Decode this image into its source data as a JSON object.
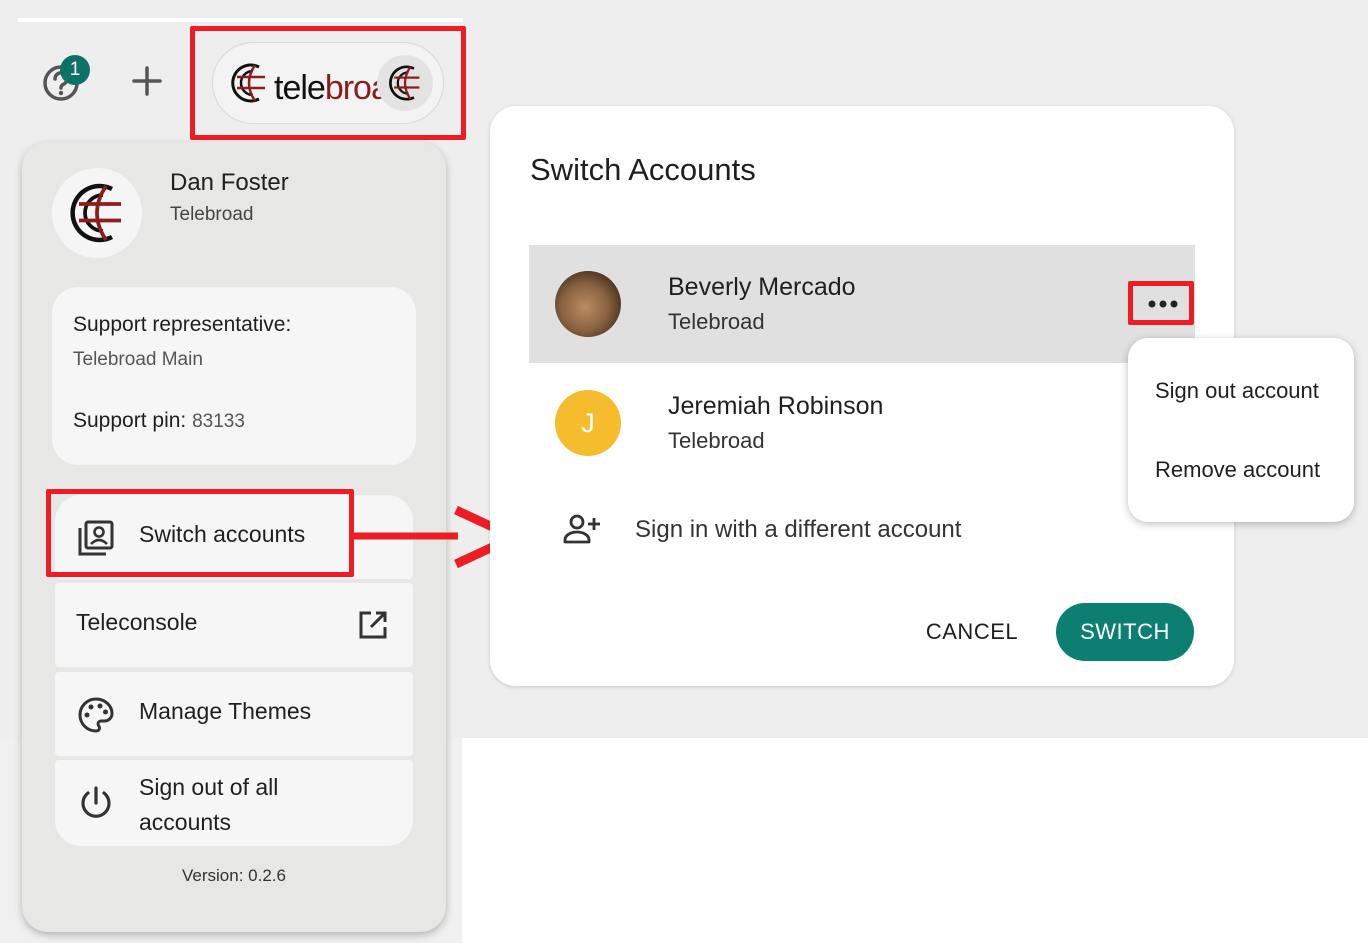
{
  "topbar": {
    "help_badge": "1",
    "logo_tele": "tele",
    "logo_broad": "broad"
  },
  "profile": {
    "name": "Dan Foster",
    "org": "Telebroad"
  },
  "support": {
    "rep_label": "Support representative:",
    "rep_value": "Telebroad Main",
    "pin_label": "Support pin:",
    "pin_value": "83133"
  },
  "menu": {
    "switch_accounts": "Switch accounts",
    "teleconsole": "Teleconsole",
    "manage_themes": "Manage Themes",
    "sign_out_all": "Sign out of all accounts"
  },
  "version": "Version: 0.2.6",
  "dialog": {
    "title": "Switch Accounts",
    "accounts": [
      {
        "name": "Beverly Mercado",
        "org": "Telebroad"
      },
      {
        "name": "Jeremiah Robinson",
        "org": "Telebroad",
        "initial": "J"
      }
    ],
    "signin_label": "Sign in with a different account",
    "cancel": "CANCEL",
    "switch": "SWITCH"
  },
  "context_menu": {
    "sign_out": "Sign out account",
    "remove": "Remove account"
  },
  "colors": {
    "accent": "#0c7f72",
    "highlight": "#ee1c24",
    "brand_red": "#8c1d1d",
    "avatar_j": "#f5bd2e"
  }
}
